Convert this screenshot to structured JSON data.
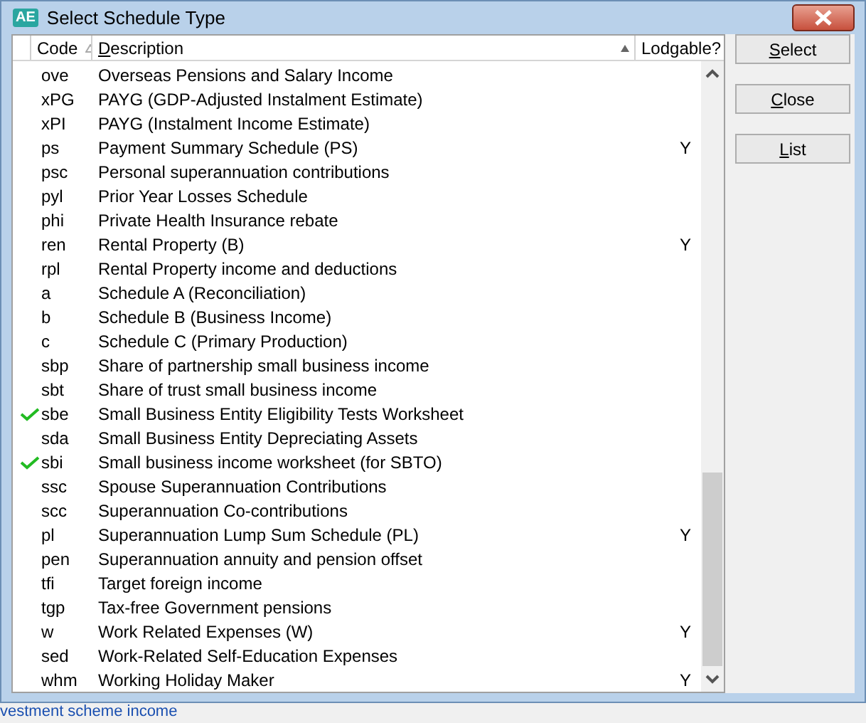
{
  "window": {
    "title": "Select Schedule Type",
    "icon": "AE"
  },
  "table": {
    "columns": [
      {
        "label": "Code"
      },
      {
        "label": "Description"
      },
      {
        "label": "Lodgable?"
      }
    ],
    "rows": [
      {
        "code": "ove",
        "description": "Overseas Pensions and Salary Income",
        "checked": false
      },
      {
        "code": "xPG",
        "description": "PAYG (GDP-Adjusted Instalment Estimate)",
        "checked": false
      },
      {
        "code": "xPI",
        "description": "PAYG (Instalment Income Estimate)",
        "checked": false
      },
      {
        "code": "ps",
        "description": "Payment Summary Schedule (PS)",
        "lodgable": "Y",
        "checked": false
      },
      {
        "code": "psc",
        "description": "Personal superannuation contributions",
        "checked": false
      },
      {
        "code": "pyl",
        "description": "Prior Year Losses Schedule",
        "checked": false
      },
      {
        "code": "phi",
        "description": "Private Health Insurance rebate",
        "checked": false
      },
      {
        "code": "ren",
        "description": "Rental Property (B)",
        "lodgable": "Y",
        "checked": false
      },
      {
        "code": "rpl",
        "description": "Rental Property income and deductions",
        "checked": false
      },
      {
        "code": "a",
        "description": "Schedule A (Reconciliation)",
        "checked": false
      },
      {
        "code": "b",
        "description": "Schedule B (Business Income)",
        "checked": false
      },
      {
        "code": "c",
        "description": "Schedule C (Primary Production)",
        "checked": false
      },
      {
        "code": "sbp",
        "description": "Share of partnership small business income",
        "checked": false
      },
      {
        "code": "sbt",
        "description": "Share of trust small business income",
        "checked": false
      },
      {
        "code": "sbe",
        "description": "Small Business Entity Eligibility Tests Worksheet",
        "checked": true
      },
      {
        "code": "sda",
        "description": "Small Business Entity Depreciating Assets",
        "checked": false
      },
      {
        "code": "sbi",
        "description": "Small business income worksheet (for SBTO)",
        "checked": true
      },
      {
        "code": "ssc",
        "description": "Spouse Superannuation Contributions",
        "checked": false
      },
      {
        "code": "scc",
        "description": "Superannuation Co-contributions",
        "checked": false
      },
      {
        "code": "pl",
        "description": "Superannuation Lump Sum Schedule (PL)",
        "lodgable": "Y",
        "checked": false
      },
      {
        "code": "pen",
        "description": "Superannuation annuity and pension offset",
        "checked": false
      },
      {
        "code": "tfi",
        "description": "Target foreign income",
        "checked": false
      },
      {
        "code": "tgp",
        "description": "Tax-free Government pensions",
        "checked": false
      },
      {
        "code": "w",
        "description": "Work Related Expenses (W)",
        "lodgable": "Y",
        "checked": false
      },
      {
        "code": "sed",
        "description": "Work-Related Self-Education Expenses",
        "checked": false
      },
      {
        "code": "whm",
        "description": "Working Holiday Maker",
        "lodgable": "Y",
        "checked": false
      }
    ]
  },
  "buttons": [
    "Select",
    "Close",
    "List"
  ],
  "background_text": "vestment scheme income"
}
